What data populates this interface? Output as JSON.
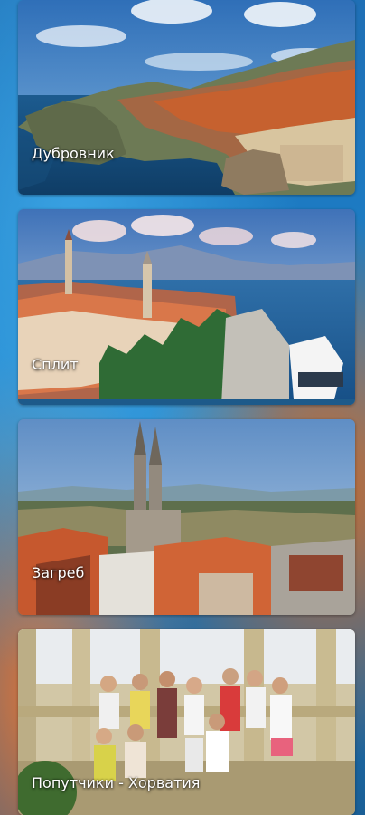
{
  "cards": [
    {
      "title": "Дубровник"
    },
    {
      "title": "Сплит"
    },
    {
      "title": "Загреб"
    },
    {
      "title": "Попутчики - Хорватия"
    }
  ],
  "colors": {
    "background": "#1c7fc7",
    "label_text": "#ffffff"
  }
}
